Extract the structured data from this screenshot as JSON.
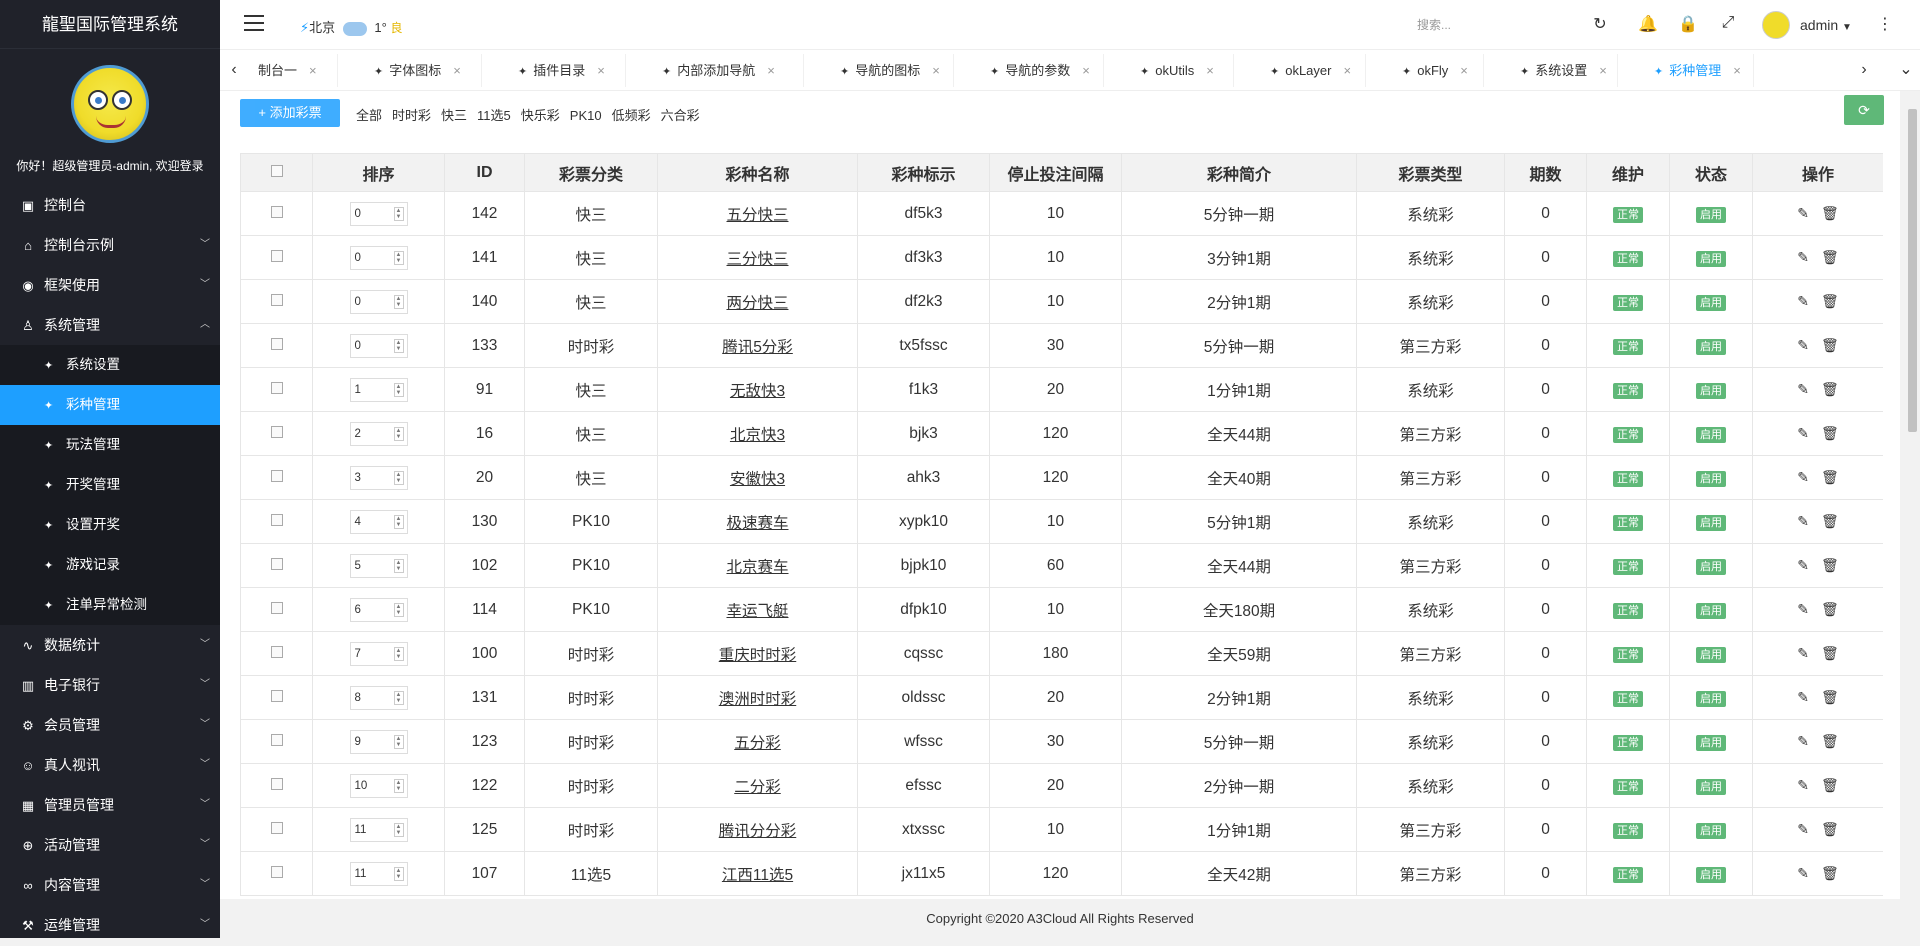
{
  "app_title": "龍聖国际管理系统",
  "welcome": "你好！超级管理员-admin, 欢迎登录",
  "sidebar": {
    "items": [
      {
        "label": "控制台",
        "icon": "dashboard-icon"
      },
      {
        "label": "控制台示例",
        "icon": "home-icon"
      },
      {
        "label": "框架使用",
        "icon": "gamepad-icon"
      },
      {
        "label": "系统管理",
        "icon": "user-icon"
      },
      {
        "label": "数据统计",
        "icon": "chart-icon"
      },
      {
        "label": "电子银行",
        "icon": "bank-icon"
      },
      {
        "label": "会员管理",
        "icon": "gear-icon"
      },
      {
        "label": "真人视讯",
        "icon": "people-icon"
      },
      {
        "label": "管理员管理",
        "icon": "grid-icon"
      },
      {
        "label": "活动管理",
        "icon": "plus-circle-icon"
      },
      {
        "label": "内容管理",
        "icon": "infinity-icon"
      },
      {
        "label": "运维管理",
        "icon": "tools-icon"
      }
    ],
    "sub_items": [
      {
        "label": "系统设置"
      },
      {
        "label": "彩种管理"
      },
      {
        "label": "玩法管理"
      },
      {
        "label": "开奖管理"
      },
      {
        "label": "设置开奖"
      },
      {
        "label": "游戏记录"
      },
      {
        "label": "注单异常检测"
      }
    ]
  },
  "header": {
    "city": "北京",
    "temp": "1°",
    "air_quality": "良",
    "search_placeholder": "搜索...",
    "user": "admin"
  },
  "tabs": [
    {
      "label": "制台一"
    },
    {
      "label": "字体图标"
    },
    {
      "label": "插件目录"
    },
    {
      "label": "内部添加导航"
    },
    {
      "label": "导航的图标"
    },
    {
      "label": "导航的参数"
    },
    {
      "label": "okUtils"
    },
    {
      "label": "okLayer"
    },
    {
      "label": "okFly"
    },
    {
      "label": "系统设置"
    },
    {
      "label": "彩种管理"
    }
  ],
  "toolbar": {
    "add_label": "+ 添加彩票",
    "filters": [
      "全部",
      "时时彩",
      "快三",
      "11选5",
      "快乐彩",
      "PK10",
      "低频彩",
      "六合彩"
    ]
  },
  "table": {
    "headers": [
      "排序",
      "ID",
      "彩票分类",
      "彩种名称",
      "彩种标示",
      "停止投注间隔",
      "彩种简介",
      "彩票类型",
      "期数",
      "维护",
      "状态",
      "操作"
    ],
    "rows": [
      {
        "order": "0",
        "id": "142",
        "cat": "快三",
        "name": "五分快三",
        "code": "df5k3",
        "gap": "10",
        "desc": "5分钟一期",
        "type": "系统彩",
        "periods": "0",
        "maint": "正常",
        "status": "启用"
      },
      {
        "order": "0",
        "id": "141",
        "cat": "快三",
        "name": "三分快三",
        "code": "df3k3",
        "gap": "10",
        "desc": "3分钟1期",
        "type": "系统彩",
        "periods": "0",
        "maint": "正常",
        "status": "启用"
      },
      {
        "order": "0",
        "id": "140",
        "cat": "快三",
        "name": "两分快三",
        "code": "df2k3",
        "gap": "10",
        "desc": "2分钟1期",
        "type": "系统彩",
        "periods": "0",
        "maint": "正常",
        "status": "启用"
      },
      {
        "order": "0",
        "id": "133",
        "cat": "时时彩",
        "name": "腾讯5分彩",
        "code": "tx5fssc",
        "gap": "30",
        "desc": "5分钟一期",
        "type": "第三方彩",
        "periods": "0",
        "maint": "正常",
        "status": "启用"
      },
      {
        "order": "1",
        "id": "91",
        "cat": "快三",
        "name": "无敌快3",
        "code": "f1k3",
        "gap": "20",
        "desc": "1分钟1期",
        "type": "系统彩",
        "periods": "0",
        "maint": "正常",
        "status": "启用"
      },
      {
        "order": "2",
        "id": "16",
        "cat": "快三",
        "name": "北京快3",
        "code": "bjk3",
        "gap": "120",
        "desc": "全天44期",
        "type": "第三方彩",
        "periods": "0",
        "maint": "正常",
        "status": "启用"
      },
      {
        "order": "3",
        "id": "20",
        "cat": "快三",
        "name": "安徽快3",
        "code": "ahk3",
        "gap": "120",
        "desc": "全天40期",
        "type": "第三方彩",
        "periods": "0",
        "maint": "正常",
        "status": "启用"
      },
      {
        "order": "4",
        "id": "130",
        "cat": "PK10",
        "name": "极速赛车",
        "code": "xypk10",
        "gap": "10",
        "desc": "5分钟1期",
        "type": "系统彩",
        "periods": "0",
        "maint": "正常",
        "status": "启用"
      },
      {
        "order": "5",
        "id": "102",
        "cat": "PK10",
        "name": "北京赛车",
        "code": "bjpk10",
        "gap": "60",
        "desc": "全天44期",
        "type": "第三方彩",
        "periods": "0",
        "maint": "正常",
        "status": "启用"
      },
      {
        "order": "6",
        "id": "114",
        "cat": "PK10",
        "name": "幸运飞艇",
        "code": "dfpk10",
        "gap": "10",
        "desc": "全天180期",
        "type": "系统彩",
        "periods": "0",
        "maint": "正常",
        "status": "启用"
      },
      {
        "order": "7",
        "id": "100",
        "cat": "时时彩",
        "name": "重庆时时彩",
        "code": "cqssc",
        "gap": "180",
        "desc": "全天59期",
        "type": "第三方彩",
        "periods": "0",
        "maint": "正常",
        "status": "启用"
      },
      {
        "order": "8",
        "id": "131",
        "cat": "时时彩",
        "name": "澳洲时时彩",
        "code": "oldssc",
        "gap": "20",
        "desc": "2分钟1期",
        "type": "系统彩",
        "periods": "0",
        "maint": "正常",
        "status": "启用"
      },
      {
        "order": "9",
        "id": "123",
        "cat": "时时彩",
        "name": "五分彩",
        "code": "wfssc",
        "gap": "30",
        "desc": "5分钟一期",
        "type": "系统彩",
        "periods": "0",
        "maint": "正常",
        "status": "启用"
      },
      {
        "order": "10",
        "id": "122",
        "cat": "时时彩",
        "name": "二分彩",
        "code": "efssc",
        "gap": "20",
        "desc": "2分钟一期",
        "type": "系统彩",
        "periods": "0",
        "maint": "正常",
        "status": "启用"
      },
      {
        "order": "11",
        "id": "125",
        "cat": "时时彩",
        "name": "腾讯分分彩",
        "code": "xtxssc",
        "gap": "10",
        "desc": "1分钟1期",
        "type": "第三方彩",
        "periods": "0",
        "maint": "正常",
        "status": "启用"
      },
      {
        "order": "11",
        "id": "107",
        "cat": "11选5",
        "name": "江西11选5",
        "code": "jx11x5",
        "gap": "120",
        "desc": "全天42期",
        "type": "第三方彩",
        "periods": "0",
        "maint": "正常",
        "status": "启用"
      }
    ]
  },
  "footer": "Copyright ©2020 A3Cloud All Rights Reserved",
  "colors": {
    "sidebar_bg": "#20222a",
    "active": "#1e9fff",
    "badge": "#5fb878"
  }
}
